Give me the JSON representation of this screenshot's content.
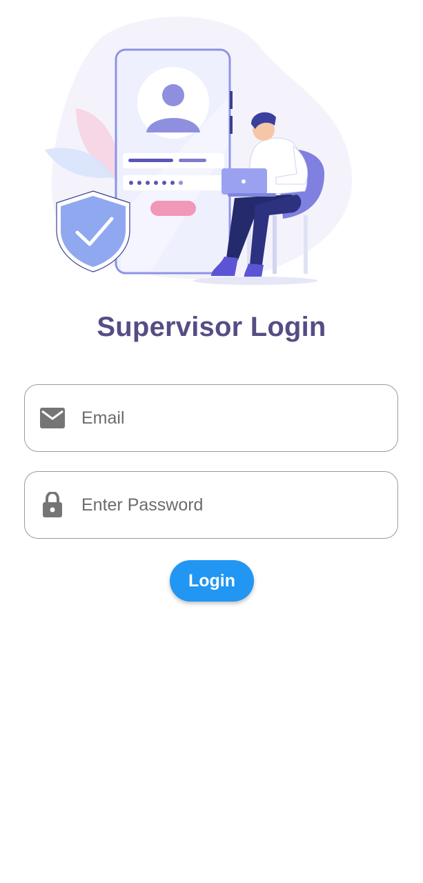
{
  "header": {
    "illustration_icon": "login-security-illustration"
  },
  "page": {
    "title": "Supervisor Login"
  },
  "form": {
    "email": {
      "icon": "mail-icon",
      "placeholder": "Email",
      "value": ""
    },
    "password": {
      "icon": "lock-icon",
      "placeholder": "Enter Password",
      "value": ""
    },
    "login_label": "Login"
  },
  "colors": {
    "title": "#564d85",
    "primary_button": "#2196f3",
    "field_border": "#9a9a9a",
    "icon_gray": "#757575"
  }
}
